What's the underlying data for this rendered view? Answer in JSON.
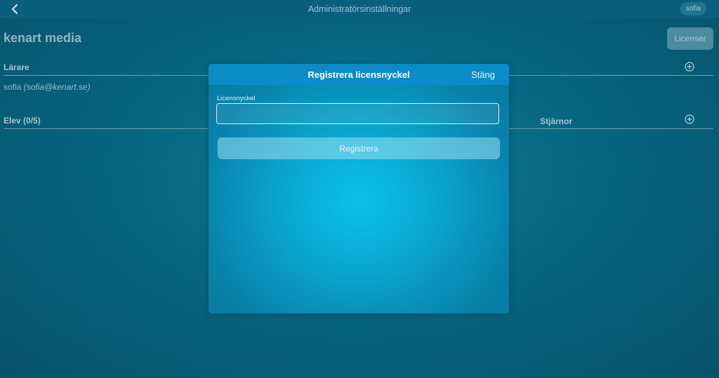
{
  "topbar": {
    "title": "Administratörsinställningar",
    "user": "sofia",
    "back_icon": "chevron-left-icon"
  },
  "org": {
    "name": "kenart media",
    "licenses_button": "Licenser"
  },
  "teachers": {
    "header": "Lärare",
    "items": [
      {
        "name": "sofia",
        "email": "(sofia@kenart.se)"
      }
    ]
  },
  "students": {
    "header": "Elev (0/5)",
    "stars_column": "Stjärnor"
  },
  "modal": {
    "title": "Registrera licensnyckel",
    "close_label": "Stäng",
    "field_label": "Licensnyckel",
    "input_value": "",
    "input_placeholder": "",
    "submit_label": "Registrera"
  },
  "colors": {
    "background": "#06657f",
    "topbar": "#0a5f7c",
    "modal_header": "#0b8cc8",
    "modal_body": "#0aa7d0"
  }
}
